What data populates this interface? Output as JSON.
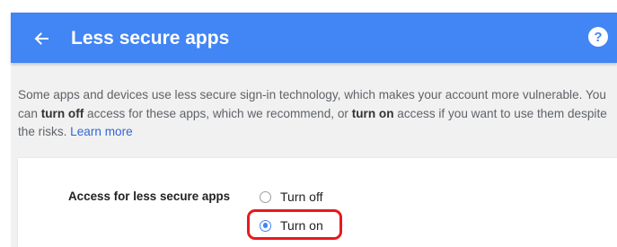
{
  "header": {
    "title": "Less secure apps",
    "back_icon": "arrow-left-icon",
    "help_icon": "question-circle-icon",
    "help_glyph": "?"
  },
  "description": {
    "text_1": "Some apps and devices use less secure sign-in technology, which makes your account more vulnerable. You can ",
    "bold_1": "turn off",
    "text_2": " access for these apps, which we recommend, or ",
    "bold_2": "turn on",
    "text_3": " access if you want to use them despite the risks. ",
    "learn_more": "Learn more"
  },
  "setting": {
    "label": "Access for less secure apps",
    "options": [
      {
        "label": "Turn off",
        "selected": false
      },
      {
        "label": "Turn on",
        "selected": true
      }
    ]
  },
  "colors": {
    "header_bg": "#4285f4",
    "link": "#3367d6",
    "radio_selected": "#4285f4",
    "annotation_outline": "#e8191f"
  }
}
